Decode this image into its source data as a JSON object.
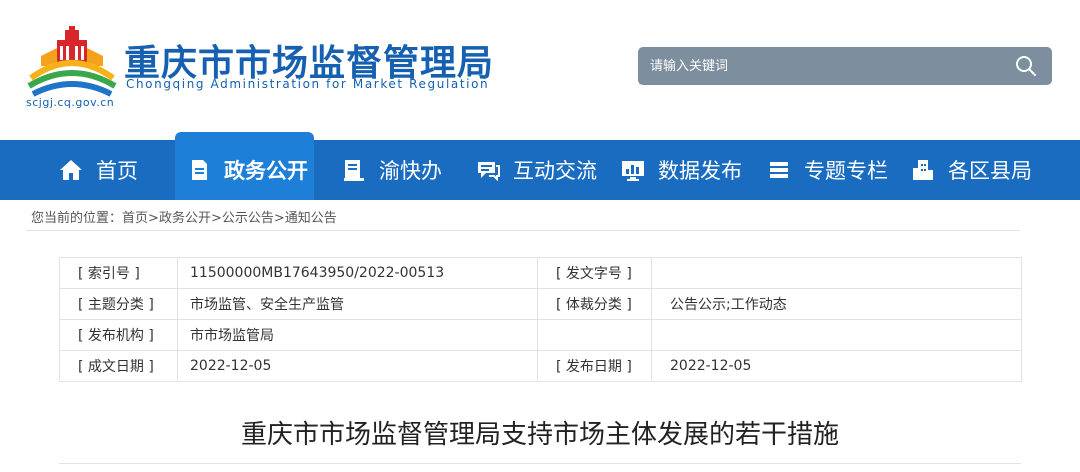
{
  "header": {
    "title": "重庆市市场监督管理局",
    "subtitle": "Chongqing Administration for Market Regulation",
    "domain": "scjgj.cq.gov.cn",
    "search_placeholder": "请输入关键词",
    "brand_color": "#1560b0"
  },
  "nav": {
    "items": [
      {
        "label": "首页",
        "icon": "home-icon"
      },
      {
        "label": "政务公开",
        "icon": "document-icon",
        "active": true
      },
      {
        "label": "渝快办",
        "icon": "book-icon"
      },
      {
        "label": "互动交流",
        "icon": "chat-icon"
      },
      {
        "label": "数据发布",
        "icon": "chart-monitor-icon"
      },
      {
        "label": "专题专栏",
        "icon": "stack-icon"
      },
      {
        "label": "各区县局",
        "icon": "building-icon"
      }
    ],
    "bg_color": "#1a6cc0",
    "active_color": "#1d7fd8"
  },
  "breadcrumb": {
    "prefix": "您当前的位置：",
    "items": [
      "首页",
      "政务公开",
      "公示公告",
      "通知公告"
    ],
    "separator": ">"
  },
  "meta": {
    "rows": [
      [
        "[ 索引号 ]",
        "11500000MB17643950/2022-00513",
        "[ 发文字号 ]",
        ""
      ],
      [
        "[ 主题分类 ]",
        "市场监管、安全生产监管",
        "[ 体裁分类 ]",
        "公告公示;工作动态"
      ],
      [
        "[ 发布机构 ]",
        "市市场监管局",
        "",
        ""
      ],
      [
        "[ 成文日期 ]",
        "2022-12-05",
        "[ 发布日期 ]",
        "2022-12-05"
      ]
    ]
  },
  "article": {
    "title": "重庆市市场监督管理局支持市场主体发展的若干措施"
  }
}
